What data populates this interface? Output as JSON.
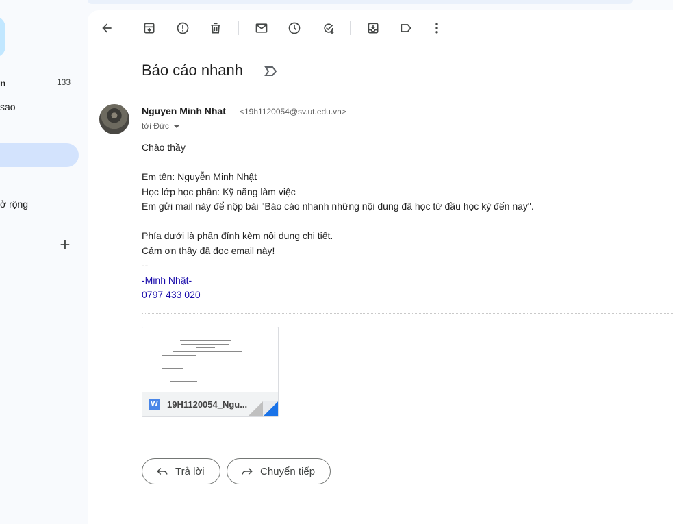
{
  "sidebar": {
    "inbox_label": "n",
    "inbox_count": "133",
    "starred_label": "sao",
    "more_label": "ở rộng",
    "add_label_symbol": "+"
  },
  "toolbar": {
    "icons": [
      "back-arrow-icon",
      "archive-icon",
      "report-spam-icon",
      "delete-icon",
      "mark-unread-icon",
      "snooze-icon",
      "add-task-icon",
      "move-to-icon",
      "label-icon",
      "more-options-icon"
    ]
  },
  "email": {
    "subject": "Báo cáo nhanh",
    "sender_name": "Nguyen Minh Nhat",
    "sender_email": "<19h1120054@sv.ut.edu.vn>",
    "to_line": "tới Đức",
    "body_lines": [
      "Chào thầy",
      "",
      "Em tên: Nguyễn Minh Nhật",
      "Học lớp học phần: Kỹ năng làm việc",
      "Em gửi mail này để nộp bài \"Báo cáo nhanh những nội dung đã học từ đầu học kỳ đến nay\".",
      "",
      "Phía dưới là phần đính kèm nội dung chi tiết.",
      "Cảm ơn thầy đã đọc email này!"
    ],
    "signature_separator": "--",
    "signature_name": "-Minh Nhật-",
    "signature_phone": "0797 433 020"
  },
  "attachment": {
    "file_icon_letter": "W",
    "file_name": "19H1120054_Ngu..."
  },
  "actions": {
    "reply_label": "Trả lời",
    "forward_label": "Chuyển tiếp"
  },
  "colors": {
    "accent_blue": "#1a0dab",
    "active_nav": "#d3e3fd",
    "word_blue": "#4a86e8"
  }
}
